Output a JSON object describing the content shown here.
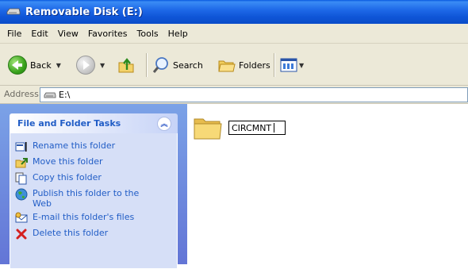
{
  "window": {
    "title": "Removable Disk (E:)"
  },
  "menu": [
    "File",
    "Edit",
    "View",
    "Favorites",
    "Tools",
    "Help"
  ],
  "toolbar": {
    "back_label": "Back",
    "search_label": "Search",
    "folders_label": "Folders"
  },
  "address": {
    "label": "Address",
    "value": "E:\\"
  },
  "tasks": {
    "title": "File and Folder Tasks",
    "items": [
      {
        "label": "Rename this folder",
        "icon": "rename-icon"
      },
      {
        "label": "Move this folder",
        "icon": "move-icon"
      },
      {
        "label": "Copy this folder",
        "icon": "copy-icon"
      },
      {
        "label": "Publish this folder to the Web",
        "icon": "globe-icon"
      },
      {
        "label": "E-mail this folder's files",
        "icon": "email-icon"
      },
      {
        "label": "Delete this folder",
        "icon": "delete-icon"
      }
    ]
  },
  "content": {
    "folder_name_edit": "CIRCMNT"
  }
}
